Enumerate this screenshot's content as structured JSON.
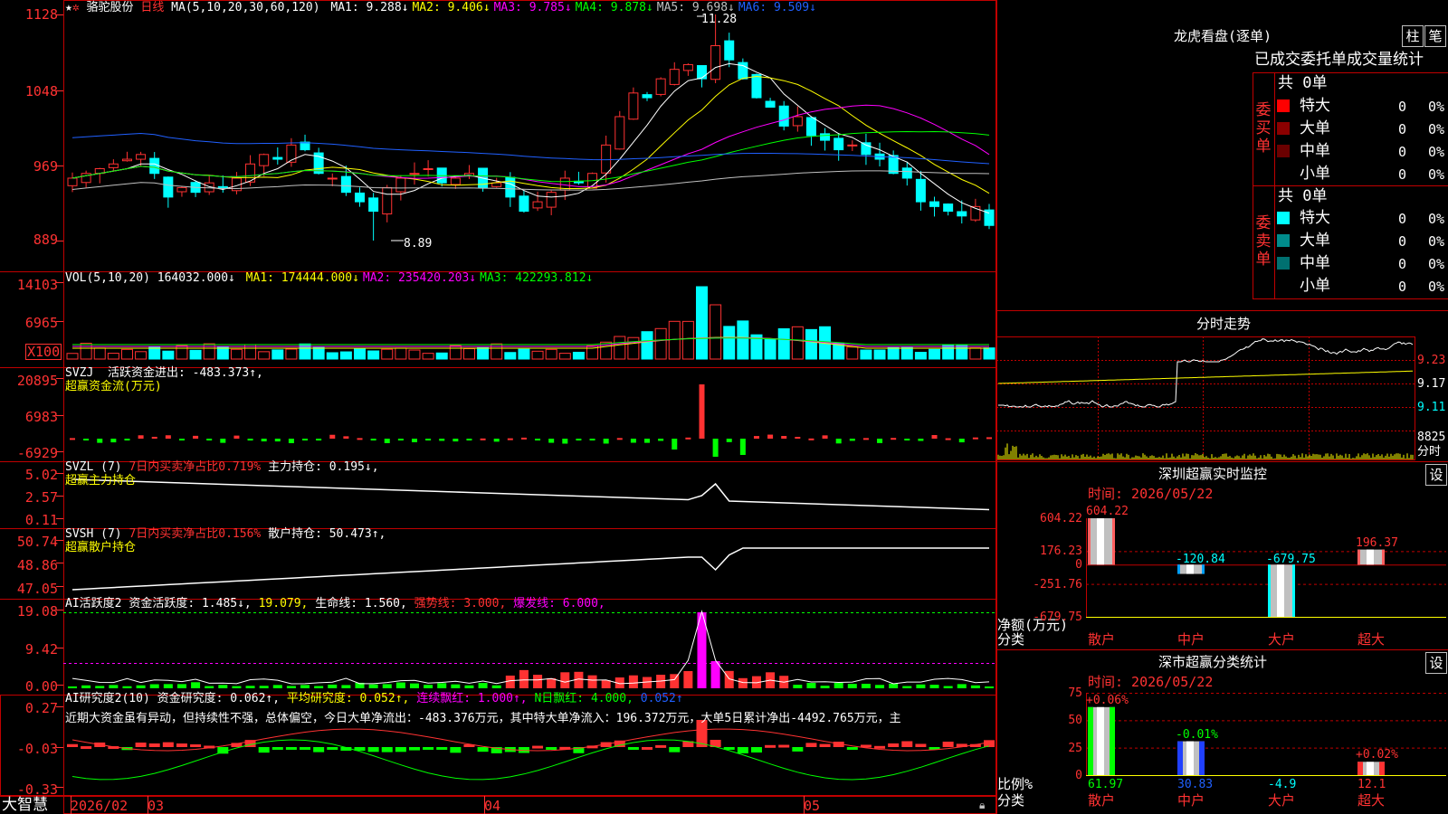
{
  "main": {
    "title_prefix": "★",
    "stock_name": "骆驼股份",
    "period": "日线",
    "ma_label": "MA(5,10,20,30,60,120)",
    "ma": [
      {
        "label": "MA1: 9.288↓",
        "color": "#ffffff"
      },
      {
        "label": "MA2: 9.406↓",
        "color": "#ffff00"
      },
      {
        "label": "MA3: 9.785↓",
        "color": "#ff00ff"
      },
      {
        "label": "MA4: 9.878↓",
        "color": "#00ff00"
      },
      {
        "label": "MA5: 9.698↓",
        "color": "#c0c0c0"
      },
      {
        "label": "MA6: 9.509↓",
        "color": "#2060ff"
      }
    ],
    "yticks": [
      "1128",
      "1048",
      "969",
      "889"
    ],
    "high_label": "11.28",
    "low_label": "8.89"
  },
  "vol": {
    "label": "VOL(5,10,20)",
    "value": "164032.000↓",
    "ma": [
      {
        "label": "MA1: 174444.000↓",
        "color": "#ffff00"
      },
      {
        "label": "MA2: 235420.203↓",
        "color": "#ff00ff"
      },
      {
        "label": "MA3: 422293.812↓",
        "color": "#00ff00"
      }
    ],
    "yticks": [
      "14103",
      "6965"
    ],
    "unit": "X100"
  },
  "svzj": {
    "label": "SVZJ",
    "text": "活跃资金进出: -483.373↑,",
    "sub": "超赢资金流(万元)",
    "yticks": [
      "20895",
      "6983",
      "-6929"
    ]
  },
  "svzl": {
    "label": "SVZL (7)",
    "pct": "7日内买卖净占比0.719%",
    "hold": "主力持仓: 0.195↓,",
    "sub": "超赢主力持仓",
    "yticks": [
      "5.02",
      "2.57",
      "0.11"
    ]
  },
  "svsh": {
    "label": "SVSH (7)",
    "pct": "7日内买卖净占比0.156%",
    "hold": "散户持仓: 50.473↑,",
    "sub": "超赢散户持仓",
    "yticks": [
      "50.74",
      "48.86",
      "47.05"
    ]
  },
  "ai1": {
    "label": "AI活跃度2",
    "a": "资金活跃度: 1.485↓,",
    "b": "19.079,",
    "c": "生命线: 1.560,",
    "d": "强势线: 3.000,",
    "e": "爆发线: 6.000,",
    "yticks": [
      "19.08",
      "9.42",
      "0.00"
    ]
  },
  "ai2": {
    "label": "AI研究度2(10)",
    "a": "资金研究度: 0.062↑,",
    "b": "平均研究度: 0.052↑,",
    "c": "连续飘红: 1.000↑,",
    "d": "N日飘红: 4.000,",
    "e": "0.052↑",
    "commentary": "近期大资金虽有异动，但持续性不强，总体偏空，今日大单净流出：-483.376万元，其中特大单净流入：196.372万元，大单5日累计净出-4492.765万元，主",
    "yticks": [
      "0.27",
      "-0.03",
      "-0.33"
    ]
  },
  "xaxis": {
    "brand": "大智慧",
    "labels": [
      "2026/02",
      "03",
      "04",
      "05"
    ]
  },
  "longhu": {
    "title": "龙虎看盘(逐单)",
    "btn_zhu": "柱",
    "btn_bi": "笔",
    "header": "已成交委托单成交量统计",
    "buy_side": "委买单",
    "sell_side": "委卖单",
    "buy_total": "共 0单",
    "sell_total": "共 0单",
    "buy_rows": [
      {
        "name": "特大",
        "count": "0",
        "pct": "0%",
        "color": "#ff0000"
      },
      {
        "name": "大单",
        "count": "0",
        "pct": "0%",
        "color": "#8b0000"
      },
      {
        "name": "中单",
        "count": "0",
        "pct": "0%",
        "color": "#6b0000"
      },
      {
        "name": "小单",
        "count": "0",
        "pct": "0%",
        "color": ""
      }
    ],
    "sell_rows": [
      {
        "name": "特大",
        "count": "0",
        "pct": "0%",
        "color": "#00ffff"
      },
      {
        "name": "大单",
        "count": "0",
        "pct": "0%",
        "color": "#008b8b"
      },
      {
        "name": "中单",
        "count": "0",
        "pct": "0%",
        "color": "#007070"
      },
      {
        "name": "小单",
        "count": "0",
        "pct": "0%",
        "color": ""
      }
    ]
  },
  "fenshi": {
    "title": "分时走势",
    "yticks": [
      "9.23",
      "9.17",
      "9.11"
    ],
    "vol_label": "8825",
    "vol_unit": "分时"
  },
  "sz_monitor": {
    "title": "深圳超赢实时监控",
    "btn": "设",
    "time": "时间: 2026/05/22",
    "axis_label": "净额(万元)",
    "axis_sub": "分类",
    "yticks": [
      "604.22",
      "176.23",
      "0",
      "-251.76",
      "-679.75"
    ]
  },
  "sz_class": {
    "title": "深市超赢分类统计",
    "btn": "设",
    "time": "时间: 2026/05/22",
    "axis_label": "比例%",
    "axis_sub": "分类",
    "yticks": [
      "75",
      "50",
      "25",
      "0"
    ]
  },
  "chart_data": [
    {
      "type": "bar",
      "title": "深圳超赢实时监控",
      "ylabel": "净额(万元)",
      "categories": [
        "散户",
        "中户",
        "大户",
        "超大"
      ],
      "values": [
        604.22,
        -120.84,
        -679.75,
        196.37
      ],
      "ylim": [
        -679.75,
        604.22
      ]
    },
    {
      "type": "bar",
      "title": "深市超赢分类统计",
      "ylabel": "比例%",
      "categories": [
        "散户",
        "中户",
        "大户",
        "超大"
      ],
      "series": [
        {
          "values": [
            61.97,
            30.83,
            -4.9,
            12.1
          ]
        },
        {
          "values": [
            "+0.06%",
            "-0.01%",
            "",
            "+0.02%"
          ]
        }
      ],
      "ylim": [
        0,
        75
      ]
    }
  ]
}
